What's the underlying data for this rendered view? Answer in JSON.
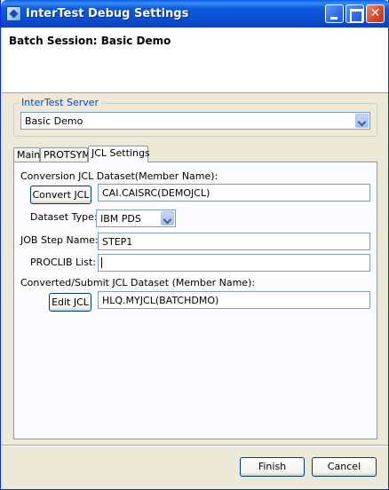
{
  "window": {
    "title": "InterTest Debug Settings"
  },
  "header": {
    "title": "Batch Session: Basic Demo"
  },
  "server": {
    "group_label": "InterTest Server",
    "selected": "Basic Demo"
  },
  "tabs": [
    {
      "label": "Main"
    },
    {
      "label": "PROTSYM"
    },
    {
      "label": "JCL Settings"
    }
  ],
  "jcl": {
    "conversion_label": "Conversion JCL Dataset(Member Name):",
    "convert_button": "Convert JCL",
    "conversion_value": "CAI.CAISRC(DEMOJCL)",
    "dataset_type_label": "Dataset Type:",
    "dataset_type_value": "IBM PDS",
    "job_step_label": "JOB Step Name:",
    "job_step_value": "STEP1",
    "proclib_label": "PROCLIB List:",
    "proclib_value": "",
    "converted_label": "Converted/Submit JCL Dataset (Member Name):",
    "edit_button": "Edit JCL",
    "converted_value": "HLQ.MYJCL(BATCHDMO)"
  },
  "footer": {
    "finish": "Finish",
    "cancel": "Cancel"
  }
}
